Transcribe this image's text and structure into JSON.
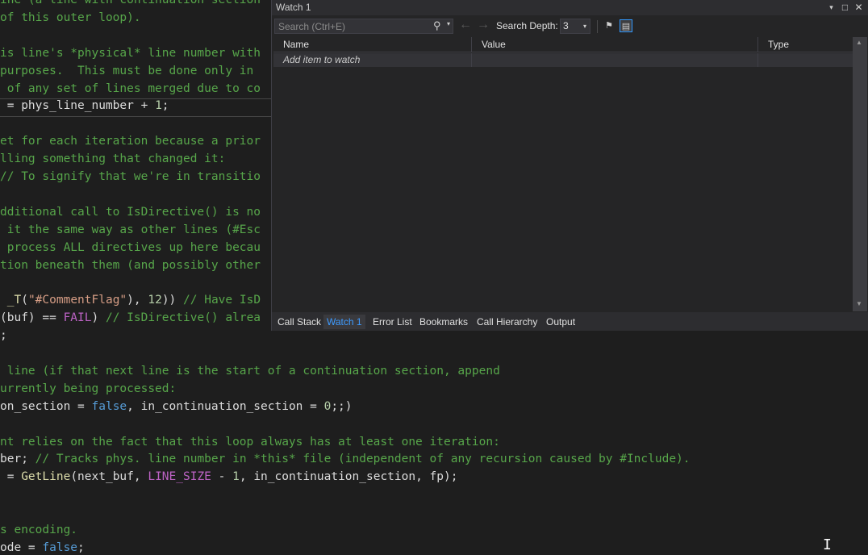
{
  "editor": {
    "lines": [
      {
        "segs": [
          [
            "c",
            "ine (a line with continuation section"
          ]
        ]
      },
      {
        "segs": [
          [
            "c",
            "of this outer loop)."
          ]
        ]
      },
      {
        "segs": [
          [
            "t",
            ""
          ]
        ]
      },
      {
        "segs": [
          [
            "c",
            "is line's *physical* line number with"
          ]
        ]
      },
      {
        "segs": [
          [
            "c",
            "purposes.  This must be done only in"
          ]
        ]
      },
      {
        "segs": [
          [
            "c",
            " of any set of lines merged due to co"
          ]
        ]
      },
      {
        "segs": [
          [
            "t",
            " = phys_line_number + "
          ],
          [
            "num",
            "1"
          ],
          [
            "t",
            ";"
          ]
        ]
      },
      {
        "segs": [
          [
            "t",
            ""
          ]
        ]
      },
      {
        "segs": [
          [
            "c",
            "et for each iteration because a prior"
          ]
        ]
      },
      {
        "segs": [
          [
            "c",
            "lling something that changed it:"
          ]
        ]
      },
      {
        "segs": [
          [
            "c",
            "// To signify that we're in transitio"
          ]
        ]
      },
      {
        "segs": [
          [
            "t",
            ""
          ]
        ]
      },
      {
        "segs": [
          [
            "c",
            "dditional call to IsDirective() is no"
          ]
        ]
      },
      {
        "segs": [
          [
            "c",
            " it the same way as other lines (#Esc"
          ]
        ]
      },
      {
        "segs": [
          [
            "c",
            " process ALL directives up here becau"
          ]
        ]
      },
      {
        "segs": [
          [
            "c",
            "tion beneath them (and possibly other"
          ]
        ]
      },
      {
        "segs": [
          [
            "t",
            ""
          ]
        ]
      },
      {
        "segs": [
          [
            "t",
            " "
          ],
          [
            "fn",
            "_T"
          ],
          [
            "t",
            "("
          ],
          [
            "str",
            "\"#CommentFlag\""
          ],
          [
            "t",
            "), "
          ],
          [
            "num",
            "12"
          ],
          [
            "t",
            ")) "
          ],
          [
            "c",
            "// Have IsD"
          ]
        ]
      },
      {
        "segs": [
          [
            "t",
            "(buf) == "
          ],
          [
            "mac",
            "FAIL"
          ],
          [
            "t",
            ") "
          ],
          [
            "c",
            "// IsDirective() alrea"
          ]
        ]
      },
      {
        "segs": [
          [
            "t",
            ";"
          ]
        ]
      },
      {
        "segs": [
          [
            "t",
            ""
          ]
        ]
      },
      {
        "segs": [
          [
            "c",
            " line (if that next line is the start of a continuation section, append"
          ]
        ]
      },
      {
        "segs": [
          [
            "c",
            "urrently being processed:"
          ]
        ]
      },
      {
        "segs": [
          [
            "t",
            "on_section = "
          ],
          [
            "kw",
            "false"
          ],
          [
            "t",
            ", in_continuation_section = "
          ],
          [
            "num",
            "0"
          ],
          [
            "t",
            ";;)"
          ]
        ]
      },
      {
        "segs": [
          [
            "t",
            ""
          ]
        ]
      },
      {
        "segs": [
          [
            "c",
            "nt relies on the fact that this loop always has at least one iteration:"
          ]
        ]
      },
      {
        "segs": [
          [
            "t",
            "ber; "
          ],
          [
            "c",
            "// Tracks phys. line number in *this* file (independent of any recursion caused by #Include)."
          ]
        ]
      },
      {
        "segs": [
          [
            "t",
            " = "
          ],
          [
            "fn",
            "GetLine"
          ],
          [
            "t",
            "(next_buf, "
          ],
          [
            "mac",
            "LINE_SIZE"
          ],
          [
            "t",
            " - "
          ],
          [
            "num",
            "1"
          ],
          [
            "t",
            ", in_continuation_section, fp);"
          ]
        ]
      },
      {
        "segs": [
          [
            "t",
            ""
          ]
        ]
      },
      {
        "segs": [
          [
            "t",
            ""
          ]
        ]
      },
      {
        "segs": [
          [
            "c",
            "s encoding."
          ]
        ]
      },
      {
        "segs": [
          [
            "t",
            "ode = "
          ],
          [
            "kw",
            "false"
          ],
          [
            "t",
            ";"
          ]
        ]
      }
    ]
  },
  "watch": {
    "title": "Watch 1",
    "search_placeholder": "Search (Ctrl+E)",
    "search_depth_label": "Search Depth:",
    "search_depth_value": "3",
    "columns": {
      "name": "Name",
      "value": "Value",
      "type": "Type"
    },
    "add_item_text": "Add item to watch",
    "icons": [
      "dropdown-icon",
      "pin-icon",
      "close-icon",
      "search-icon",
      "back-arrow-icon",
      "forward-arrow-icon",
      "filter-pin-icon",
      "columns-icon"
    ]
  },
  "bottom_tabs": [
    "Call Stack",
    "Watch 1",
    "Error List",
    "Bookmarks",
    "Call Hierarchy",
    "Output"
  ],
  "active_tab": "Watch 1",
  "colors": {
    "accent": "#3e9bff",
    "comment": "#57a64a",
    "keyword": "#569cd6",
    "macro": "#bd63c5",
    "string": "#d69d85",
    "number": "#b5cea8",
    "function": "#dcdcaa"
  }
}
